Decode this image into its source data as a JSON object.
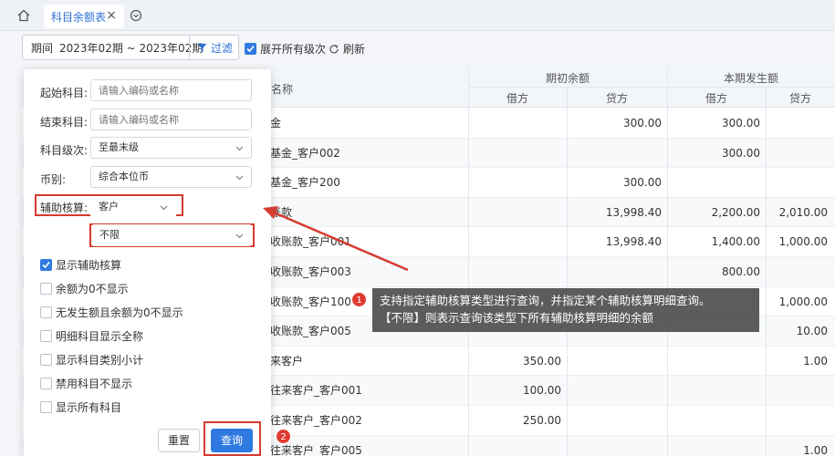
{
  "tabbar": {
    "tab_label": "科目余额表",
    "close": "×"
  },
  "toolbar": {
    "period_label": "期间",
    "period_value": "2023年02期 ~ 2023年02期",
    "filter_label": "过滤",
    "expand_label": "展开所有级次",
    "refresh_label": "刷新"
  },
  "table": {
    "col_name": "名称",
    "group_opening": "期初余额",
    "group_current": "本期发生额",
    "sub_debit": "借方",
    "sub_credit": "贷方",
    "rows": [
      {
        "name": "金",
        "open_debit": "",
        "open_credit": "300.00",
        "cur_debit": "300.00",
        "cur_credit": ""
      },
      {
        "name": "基金_客户002",
        "open_debit": "",
        "open_credit": "",
        "cur_debit": "300.00",
        "cur_credit": ""
      },
      {
        "name": "基金_客户200",
        "open_debit": "",
        "open_credit": "300.00",
        "cur_debit": "",
        "cur_credit": ""
      },
      {
        "name": "账款",
        "open_debit": "",
        "open_credit": "13,998.40",
        "cur_debit": "2,200.00",
        "cur_credit": "2,010.00"
      },
      {
        "name": "收账款_客户001",
        "open_debit": "",
        "open_credit": "13,998.40",
        "cur_debit": "1,400.00",
        "cur_credit": "1,000.00"
      },
      {
        "name": "收账款_客户003",
        "open_debit": "",
        "open_credit": "",
        "cur_debit": "800.00",
        "cur_credit": ""
      },
      {
        "name": "收账款_客户100",
        "open_debit": "",
        "open_credit": "",
        "cur_debit": "",
        "cur_credit": "1,000.00"
      },
      {
        "name": "收账款_客户005",
        "open_debit": "",
        "open_credit": "",
        "cur_debit": "",
        "cur_credit": "10.00"
      },
      {
        "name": "来客户",
        "open_debit": "350.00",
        "open_credit": "",
        "cur_debit": "",
        "cur_credit": "1.00"
      },
      {
        "name": "往来客户_客户001",
        "open_debit": "100.00",
        "open_credit": "",
        "cur_debit": "",
        "cur_credit": ""
      },
      {
        "name": "往来客户_客户002",
        "open_debit": "250.00",
        "open_credit": "",
        "cur_debit": "",
        "cur_credit": ""
      },
      {
        "name": "往来客户_客户005",
        "open_debit": "",
        "open_credit": "",
        "cur_debit": "",
        "cur_credit": "1.00"
      }
    ]
  },
  "filter_panel": {
    "start_label": "起始科目:",
    "start_placeholder": "请输入编码或名称",
    "end_label": "结束科目:",
    "end_placeholder": "请输入编码或名称",
    "level_label": "科目级次:",
    "level_value": "至最末级",
    "currency_label": "币别:",
    "currency_value": "综合本位币",
    "aux_label": "辅助核算:",
    "aux_type_value": "客户",
    "aux_detail_value": "不限",
    "options": [
      {
        "label": "显示辅助核算",
        "checked": true
      },
      {
        "label": "余额为0不显示",
        "checked": false
      },
      {
        "label": "无发生额且余额为0不显示",
        "checked": false
      },
      {
        "label": "明细科目显示全称",
        "checked": false
      },
      {
        "label": "显示科目类别小计",
        "checked": false
      },
      {
        "label": "禁用科目不显示",
        "checked": false
      },
      {
        "label": "显示所有科目",
        "checked": false
      }
    ],
    "reset_label": "重置",
    "query_label": "查询"
  },
  "annotation": {
    "badge1": "1",
    "badge2": "2",
    "line1": "支持指定辅助核算类型进行查询，并指定某个辅助核算明细查询。",
    "line2": "【不限】则表示查询该类型下所有辅助核算明细的余额"
  },
  "colors": {
    "accent": "#2f7ae0",
    "highlight": "#d63b2f",
    "tooltip_bg": "#464646"
  }
}
